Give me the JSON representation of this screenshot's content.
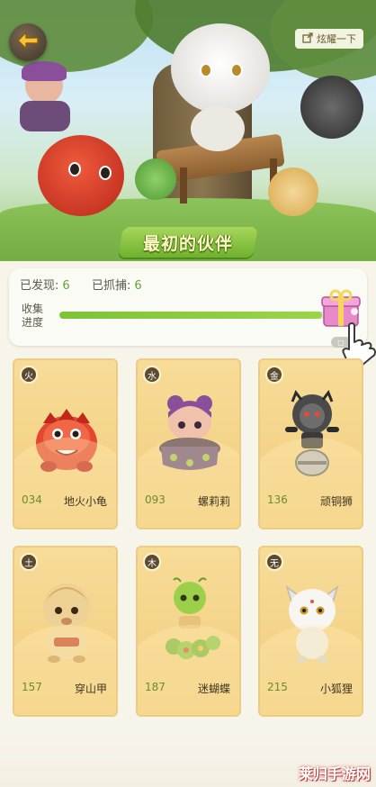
{
  "header": {
    "share_label": "炫耀一下",
    "title": "最初的伙伴"
  },
  "stats": {
    "discovered_label": "已发现:",
    "discovered_value": "6",
    "captured_label": "已抓捕:",
    "captured_value": "6",
    "progress_label": "收集进度",
    "progress_fraction": 0.98
  },
  "cards": [
    {
      "element": "火",
      "number": "034",
      "name": "地火小龟"
    },
    {
      "element": "水",
      "number": "093",
      "name": "螺莉莉"
    },
    {
      "element": "金",
      "number": "136",
      "name": "顽铜狮"
    },
    {
      "element": "土",
      "number": "157",
      "name": "穿山甲"
    },
    {
      "element": "木",
      "number": "187",
      "name": "迷蝴蝶"
    },
    {
      "element": "无",
      "number": "215",
      "name": "小狐狸"
    }
  ],
  "watermark": "莱归手游网",
  "colors": {
    "accent_green": "#7ec236",
    "card_bg": "#f3d488",
    "badge_bg": "#5b4c31"
  },
  "icons": {
    "back": "arrow-left-icon",
    "share": "share-icon",
    "gift": "gift-box-icon",
    "hand": "pointing-hand-icon"
  }
}
